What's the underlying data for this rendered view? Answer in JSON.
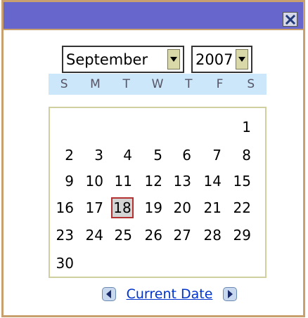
{
  "icons": {
    "close": "close-icon",
    "dropdown": "dropdown-arrow-icon",
    "previous": "arrow-left-icon",
    "next": "arrow-right-icon"
  },
  "colors": {
    "title_bar": "#6666cc",
    "frame_border": "#c8a070",
    "day_header_bg": "#cce6fa",
    "selected_border": "#b23232",
    "link": "#0033cc"
  },
  "month_select": {
    "value": "September"
  },
  "year_select": {
    "value": "2007"
  },
  "day_headers": [
    "S",
    "M",
    "T",
    "W",
    "T",
    "F",
    "S"
  ],
  "days": [
    "1",
    "2",
    "3",
    "4",
    "5",
    "6",
    "7",
    "8",
    "9",
    "10",
    "11",
    "12",
    "13",
    "14",
    "15",
    "16",
    "17",
    "18",
    "19",
    "20",
    "21",
    "22",
    "23",
    "24",
    "25",
    "26",
    "27",
    "28",
    "29",
    "30"
  ],
  "first_weekday_index": 6,
  "selected_day": "18",
  "footer": {
    "current_date_label": "Current Date"
  }
}
